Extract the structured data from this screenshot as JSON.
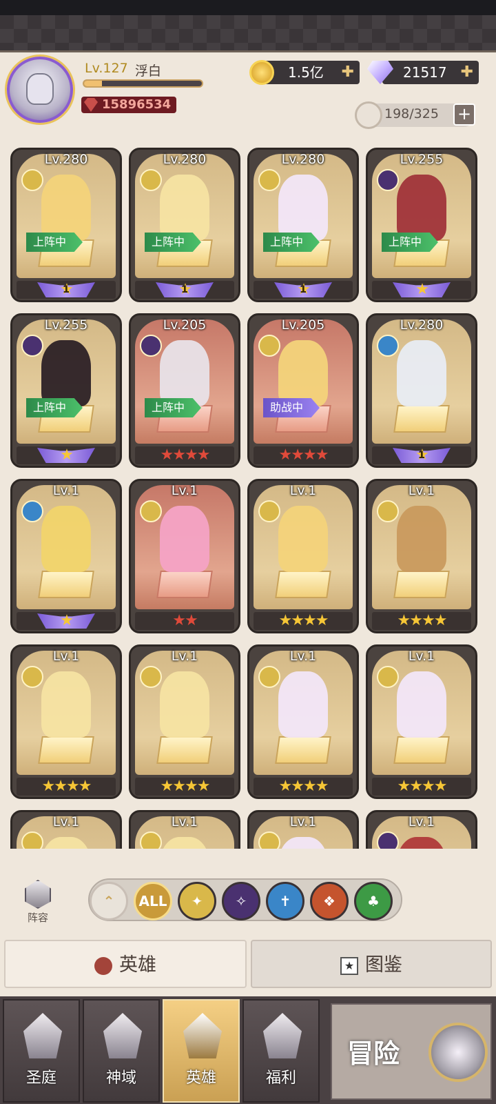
{
  "player": {
    "level": "Lv.127",
    "name": "浮白",
    "exp_fraction": 0.15,
    "power": "15896534"
  },
  "resources": {
    "gold": "1.5亿",
    "diamonds": "21517",
    "unit_count": "198/325"
  },
  "cards": [
    {
      "level": "Lv.280",
      "badge": "上阵中",
      "star_text": "1",
      "stars": "",
      "red": false,
      "faction": "light",
      "wing": true
    },
    {
      "level": "Lv.280",
      "badge": "上阵中",
      "star_text": "1",
      "stars": "",
      "red": false,
      "faction": "light",
      "wing": true
    },
    {
      "level": "Lv.280",
      "badge": "上阵中",
      "star_text": "1",
      "stars": "",
      "red": false,
      "faction": "light",
      "wing": true
    },
    {
      "level": "Lv.255",
      "badge": "上阵中",
      "star_text": "",
      "stars": "★",
      "red": false,
      "faction": "dark",
      "wing": true
    },
    {
      "level": "Lv.255",
      "badge": "上阵中",
      "star_text": "",
      "stars": "★",
      "red": false,
      "faction": "dark",
      "wing": true
    },
    {
      "level": "Lv.205",
      "badge": "上阵中",
      "star_text": "",
      "stars": "★★★★",
      "red": true,
      "faction": "dark",
      "wing": false
    },
    {
      "level": "Lv.205",
      "badge": "助战中",
      "star_text": "",
      "stars": "★★★★",
      "red": true,
      "faction": "light",
      "wing": false
    },
    {
      "level": "Lv.280",
      "badge": "",
      "star_text": "1",
      "stars": "",
      "red": false,
      "faction": "holy",
      "wing": true
    },
    {
      "level": "Lv.1",
      "badge": "",
      "star_text": "",
      "stars": "★",
      "red": false,
      "faction": "holy",
      "wing": true
    },
    {
      "level": "Lv.1",
      "badge": "",
      "star_text": "",
      "stars": "★★",
      "red": true,
      "faction": "light",
      "wing": false
    },
    {
      "level": "Lv.1",
      "badge": "",
      "star_text": "",
      "stars": "★★★★",
      "red": false,
      "faction": "light",
      "wing": false
    },
    {
      "level": "Lv.1",
      "badge": "",
      "star_text": "",
      "stars": "★★★★",
      "red": false,
      "faction": "light",
      "wing": false
    },
    {
      "level": "Lv.1",
      "badge": "",
      "star_text": "",
      "stars": "★★★★",
      "red": false,
      "faction": "light",
      "wing": false
    },
    {
      "level": "Lv.1",
      "badge": "",
      "star_text": "",
      "stars": "★★★★",
      "red": false,
      "faction": "light",
      "wing": false
    },
    {
      "level": "Lv.1",
      "badge": "",
      "star_text": "",
      "stars": "★★★★",
      "red": false,
      "faction": "light",
      "wing": false
    },
    {
      "level": "Lv.1",
      "badge": "",
      "star_text": "",
      "stars": "★★★★",
      "red": false,
      "faction": "light",
      "wing": false
    },
    {
      "level": "Lv.1",
      "badge": "",
      "star_text": "",
      "stars": "",
      "red": false,
      "faction": "light",
      "wing": false
    },
    {
      "level": "Lv.1",
      "badge": "",
      "star_text": "",
      "stars": "",
      "red": false,
      "faction": "light",
      "wing": false
    },
    {
      "level": "Lv.1",
      "badge": "",
      "star_text": "",
      "stars": "",
      "red": false,
      "faction": "light",
      "wing": false
    },
    {
      "level": "Lv.1",
      "badge": "",
      "star_text": "",
      "stars": "",
      "red": false,
      "faction": "dark",
      "wing": false
    }
  ],
  "squad": {
    "label": "阵容"
  },
  "filters": [
    {
      "id": "collapse",
      "label": "⌃",
      "color": "#e9e3da"
    },
    {
      "id": "all",
      "label": "ALL",
      "color": "#c99a3a"
    },
    {
      "id": "light",
      "label": "✦",
      "color": "#d9b84a"
    },
    {
      "id": "dark",
      "label": "✧",
      "color": "#4a3170"
    },
    {
      "id": "holy",
      "label": "✝",
      "color": "#3a86c8"
    },
    {
      "id": "beast",
      "label": "❖",
      "color": "#c5542e"
    },
    {
      "id": "nature",
      "label": "♣",
      "color": "#3d9a45"
    }
  ],
  "tabs": {
    "heroes": "英雄",
    "codex": "图鉴"
  },
  "nav": [
    {
      "label": "圣庭",
      "active": false
    },
    {
      "label": "神域",
      "active": false
    },
    {
      "label": "英雄",
      "active": true
    },
    {
      "label": "福利",
      "active": false
    }
  ],
  "adventure": {
    "label": "冒险"
  },
  "colors": {
    "light": "#d9b84a",
    "dark": "#4a3170",
    "holy": "#3a86c8"
  }
}
